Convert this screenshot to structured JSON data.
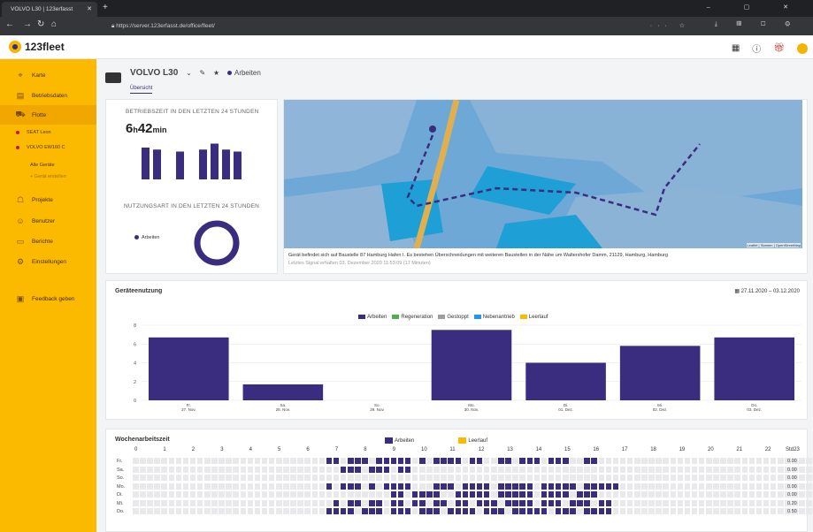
{
  "browser": {
    "tab_title": "VOLVO L30 | 123erfasst",
    "new_tab": "+",
    "url": "https://server.123erfasst.de/office/fleet/",
    "window_controls": "– ▢ ✕"
  },
  "app": {
    "logo_text": "123fleet"
  },
  "sidebar": {
    "items": [
      {
        "label": "Karte",
        "icon": "map-pin-icon"
      },
      {
        "label": "Betriebsdaten",
        "icon": "chart-icon"
      },
      {
        "label": "Flotte",
        "icon": "excavator-icon"
      },
      {
        "label": "Projekte",
        "icon": "people-icon"
      },
      {
        "label": "Benutzer",
        "icon": "users-icon"
      },
      {
        "label": "Berichte",
        "icon": "report-icon"
      },
      {
        "label": "Einstellungen",
        "icon": "gear-icon"
      },
      {
        "label": "Feedback geben",
        "icon": "feedback-icon"
      }
    ],
    "fleet_sub": [
      "SEAT Leon",
      "VOLVO EW160 C"
    ],
    "all_devices": "Alle Geräte",
    "add_device": "+ Gerät erstellen"
  },
  "device": {
    "name": "VOLVO L30",
    "status": "Arbeiten",
    "tab": "Übersicht"
  },
  "ops": {
    "title": "BETRIEBSZEIT IN DEN LETZTEN 24 STUNDEN",
    "hours": "6",
    "h_unit": "h",
    "minutes": "42",
    "min_unit": "min",
    "usage_title": "NUTZUNGSART IN DEN LETZTEN 24 STUNDEN",
    "usage_legend": "Arbeiten",
    "mini_bars": [
      0.8,
      0.75,
      0.0,
      0.7,
      0.0,
      0.75,
      0.9,
      0.75,
      0.7
    ]
  },
  "map": {
    "caption": "Gerät befindet sich auf Baustelle 87 Hamburg Hafen I. Es bestehen Überschneidungen mit weiteren Baustellen in der Nähe um Waltershofer Damm, 21129, Hamburg, Hamburg",
    "last_signal": "Letztes Signal erhalten 03. Dezember 2020 11:53:09 (17 Minuten)",
    "attribution": "Leaflet | Stamen | OpenStreetMap"
  },
  "usage": {
    "title": "Geräteenutzung",
    "date_range": "27.11.2020 – 03.12.2020"
  },
  "chart_data": {
    "type": "bar",
    "categories": [
      [
        "Fr.",
        "27. Nov."
      ],
      [
        "Sa.",
        "28. Nov."
      ],
      [
        "So.",
        "29. Nov."
      ],
      [
        "Mo.",
        "30. Nov."
      ],
      [
        "Di.",
        "01. Dez."
      ],
      [
        "Mi.",
        "02. Dez."
      ],
      [
        "Do.",
        "03. Dez."
      ]
    ],
    "series": [
      {
        "name": "Arbeiten",
        "color": "#3a2d80",
        "values": [
          6.7,
          1.7,
          0,
          7.5,
          4.0,
          5.8,
          6.7
        ]
      },
      {
        "name": "Regeneration",
        "color": "#4caf50",
        "values": [
          0,
          0,
          0,
          0,
          0,
          0,
          0
        ]
      },
      {
        "name": "Gestoppt",
        "color": "#9e9e9e",
        "values": [
          0,
          0,
          0,
          0,
          0,
          0,
          0
        ]
      },
      {
        "name": "Nebenantrieb",
        "color": "#2196f3",
        "values": [
          0,
          0,
          0,
          0,
          0,
          0,
          0
        ]
      },
      {
        "name": "Leerlauf",
        "color": "#fbb900",
        "values": [
          0,
          0,
          0,
          0,
          0,
          0,
          0
        ]
      }
    ],
    "ylim": [
      0,
      8
    ],
    "yticks": [
      0,
      2,
      4,
      6,
      8
    ],
    "grid": true,
    "legend": "top-center"
  },
  "weekly": {
    "title": "Wochenarbeitszeit",
    "legend": [
      {
        "label": "Arbeiten",
        "color": "#3a2d80"
      },
      {
        "label": "Leerlauf",
        "color": "#fbb900"
      }
    ],
    "hours": [
      "0",
      "1",
      "2",
      "3",
      "4",
      "5",
      "6",
      "7",
      "8",
      "9",
      "10",
      "11",
      "12",
      "13",
      "14",
      "15",
      "16",
      "17",
      "18",
      "19",
      "20",
      "21",
      "22",
      "23"
    ],
    "std_label": "Std.",
    "days": [
      {
        "label": "Fr.",
        "total": "0.00",
        "cells": "0000000000000000000000000001101110111110101111011001101110111001100000000000000000000000000000000"
      },
      {
        "label": "Sa.",
        "total": "0.00",
        "cells": "0000000000000000000000000000011101110110000000000000000000000000000000000000000000000000000000000"
      },
      {
        "label": "So.",
        "total": "0.00",
        "cells": "0000000000000000000000000000000000000000000000000000000000000000000000000000000000000000000000000"
      },
      {
        "label": "Mo.",
        "total": "0.00",
        "cells": "0000000000000000000000000001011101011110001110111101111101111101111100000000000000000000000000000"
      },
      {
        "label": "Di.",
        "total": "0.00",
        "cells": "0000000000000000000000000000000000001101111001111101111101111011100000000000000000000000000000000"
      },
      {
        "label": "Mi.",
        "total": "0.20",
        "cells": "0000000000000000000000000000101101101101101101101110111101110111011000000000000000000000000000000"
      },
      {
        "label": "Do.",
        "total": "0.50",
        "cells": "0000000000000000000000000001111011101110111011110111011111011101111000000000000000000000000000000"
      }
    ]
  }
}
